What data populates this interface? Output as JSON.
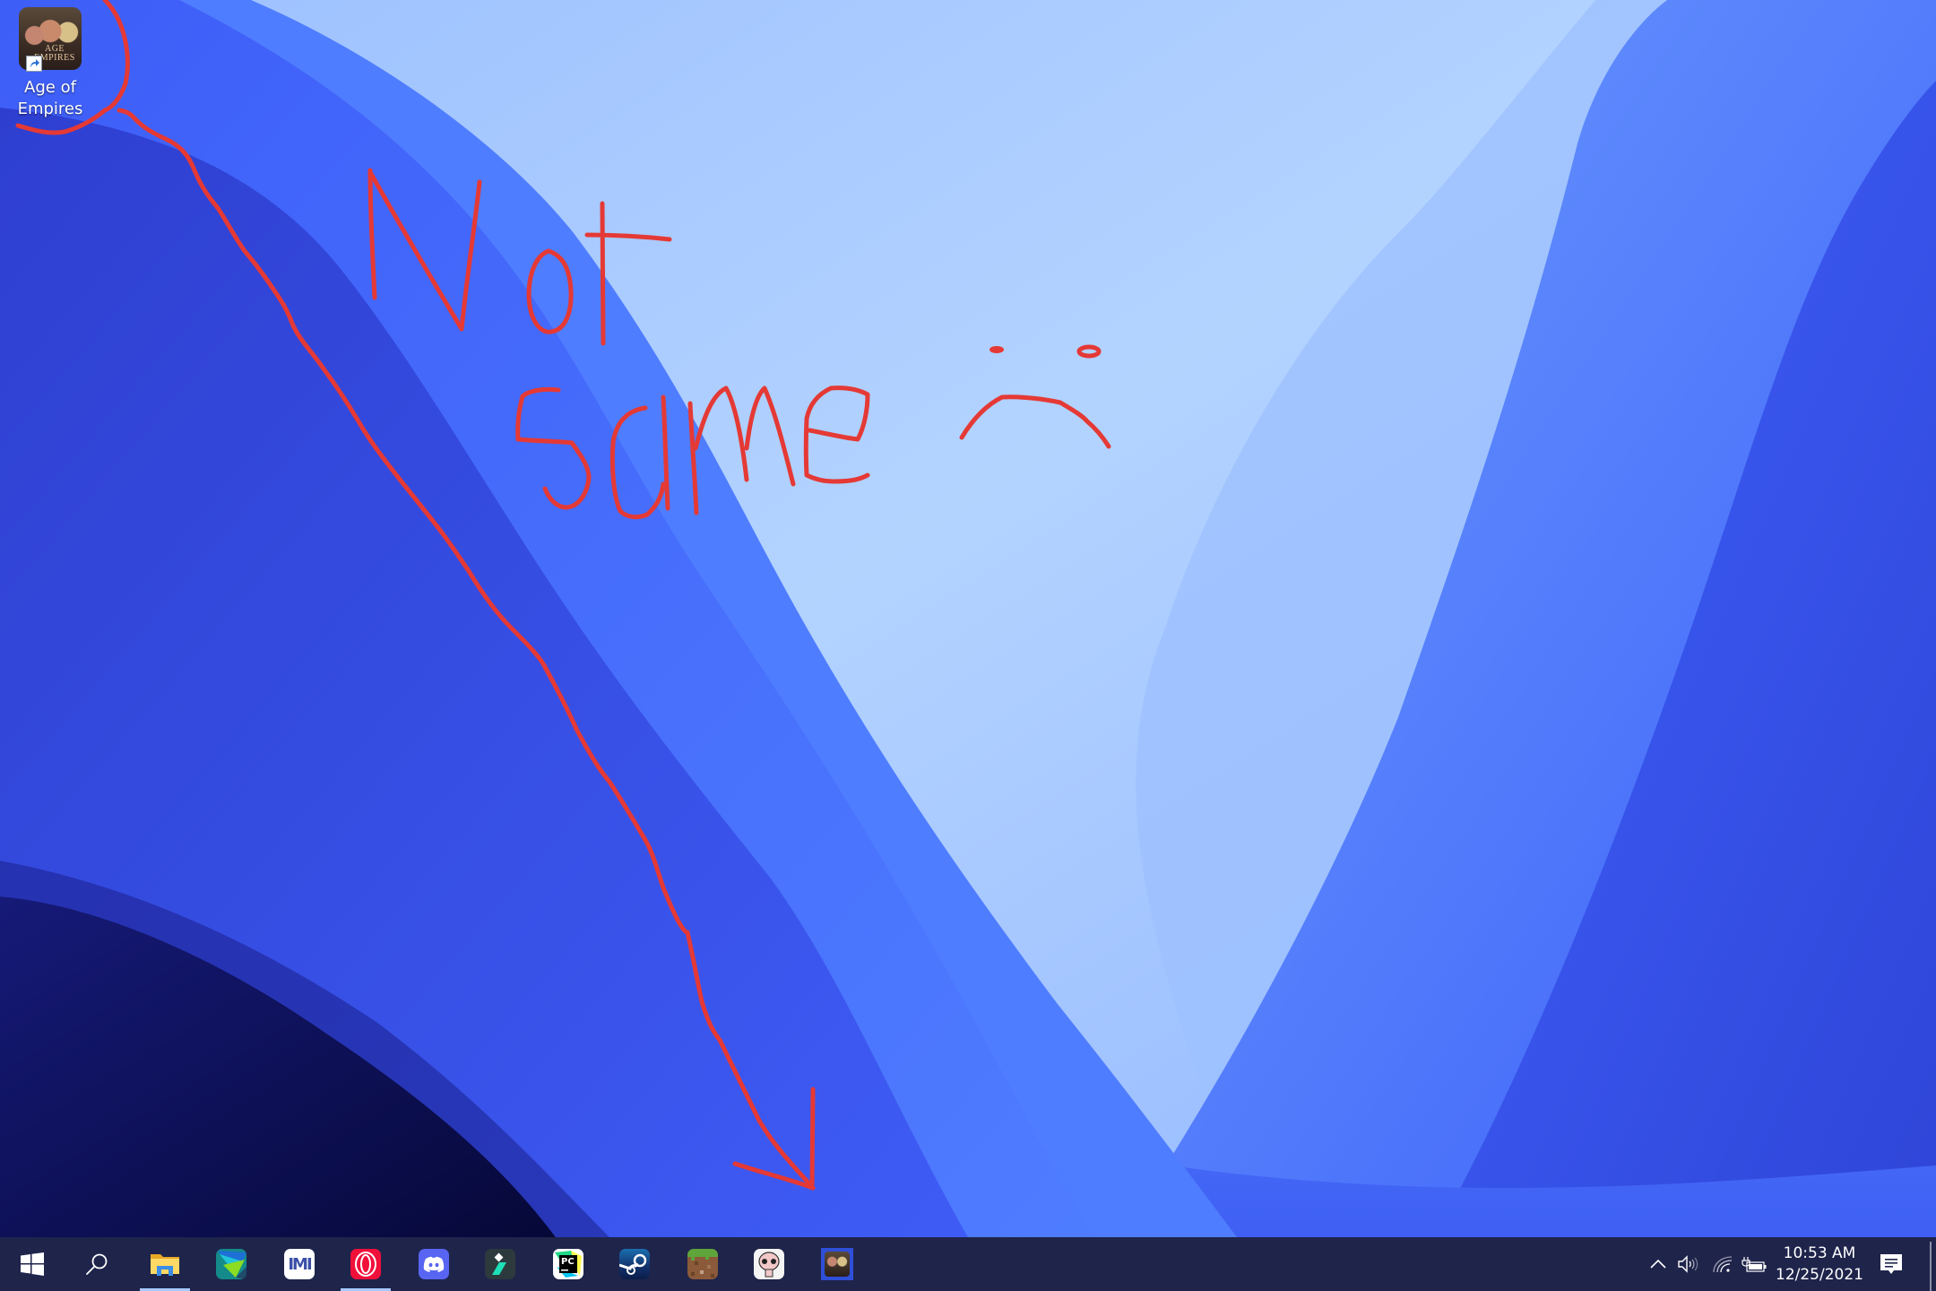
{
  "desktop": {
    "icons": [
      {
        "label_line1": "Age of",
        "label_line2": "Empires",
        "icon": "age-of-empires-icon",
        "art_text_top": "AGE",
        "art_text_bottom": "EMPIRES",
        "shortcut": true
      }
    ],
    "wallpaper_colors": {
      "sky_light": "#afd0ff",
      "mid_light": "#8fb5ff",
      "mid_blue": "#5a8aff",
      "blue": "#3d5cf5",
      "deep_blue": "#2f3fd6",
      "navy": "#0e1160",
      "navy_dark": "#070a3a"
    }
  },
  "annotation": {
    "color": "#e53935",
    "text_line1": "Not",
    "text_line2": "same",
    "emoticon": "sad-face",
    "arrow": "from-icon-to-taskbar"
  },
  "taskbar": {
    "background": "#1f244b",
    "indicator_color": "#a8c8ff",
    "start_label": "Start",
    "search_label": "Search",
    "apps": [
      {
        "name": "File Explorer",
        "icon": "file-explorer-icon",
        "running": true
      },
      {
        "name": "Maps/Paint app",
        "icon": "colorful-app-icon",
        "running": false
      },
      {
        "name": "M app",
        "icon": "m-app-icon",
        "running": false,
        "glyph": "IMI"
      },
      {
        "name": "Opera GX",
        "icon": "opera-icon",
        "running": true
      },
      {
        "name": "Discord",
        "icon": "discord-icon",
        "running": false
      },
      {
        "name": "Filmora",
        "icon": "filmora-icon",
        "running": false
      },
      {
        "name": "PyCharm",
        "icon": "pycharm-icon",
        "running": false,
        "glyph": "PC"
      },
      {
        "name": "Steam",
        "icon": "steam-icon",
        "running": false
      },
      {
        "name": "Minecraft",
        "icon": "minecraft-icon",
        "running": false
      },
      {
        "name": "The Binding of Isaac",
        "icon": "isaac-icon",
        "running": false
      },
      {
        "name": "Age of Empires",
        "icon": "age-of-empires-icon",
        "running": false,
        "highlighted": true
      }
    ],
    "tray": {
      "chevron": "show-hidden-icons",
      "volume": "speaker-icon",
      "network": "wifi-icon",
      "battery": "battery-charging-icon",
      "time": "10:53 AM",
      "date": "12/25/2021",
      "notifications": "action-center-icon"
    }
  }
}
